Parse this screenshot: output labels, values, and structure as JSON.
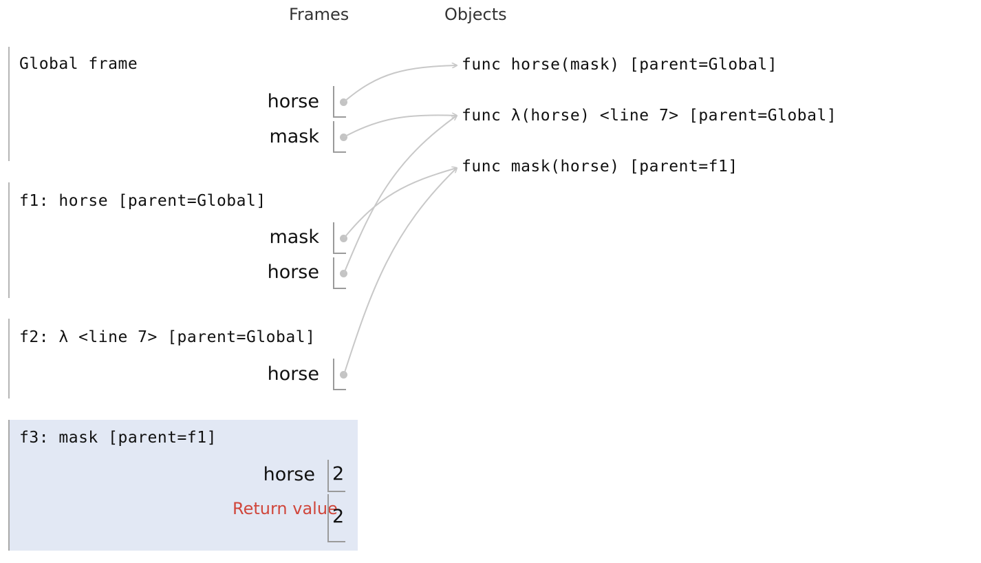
{
  "headers": {
    "frames": "Frames",
    "objects": "Objects"
  },
  "frames": [
    {
      "title": "Global frame",
      "vars": [
        {
          "name": "horse"
        },
        {
          "name": "mask"
        }
      ]
    },
    {
      "title": "f1: horse [parent=Global]",
      "vars": [
        {
          "name": "mask"
        },
        {
          "name": "horse"
        }
      ]
    },
    {
      "title": "f2: λ <line 7> [parent=Global]",
      "vars": [
        {
          "name": "horse"
        }
      ]
    },
    {
      "title": "f3: mask [parent=f1]",
      "vars": [
        {
          "name": "horse",
          "value": "2"
        }
      ],
      "return_label": "Return value",
      "return_value": "2"
    }
  ],
  "objects": [
    "func horse(mask) [parent=Global]",
    "func λ(horse) <line 7> [parent=Global]",
    "func mask(horse) [parent=f1]"
  ],
  "colors": {
    "active_frame": "#e2e8f4",
    "return_label": "#d0463b",
    "arrow": "#c8c8c8"
  }
}
